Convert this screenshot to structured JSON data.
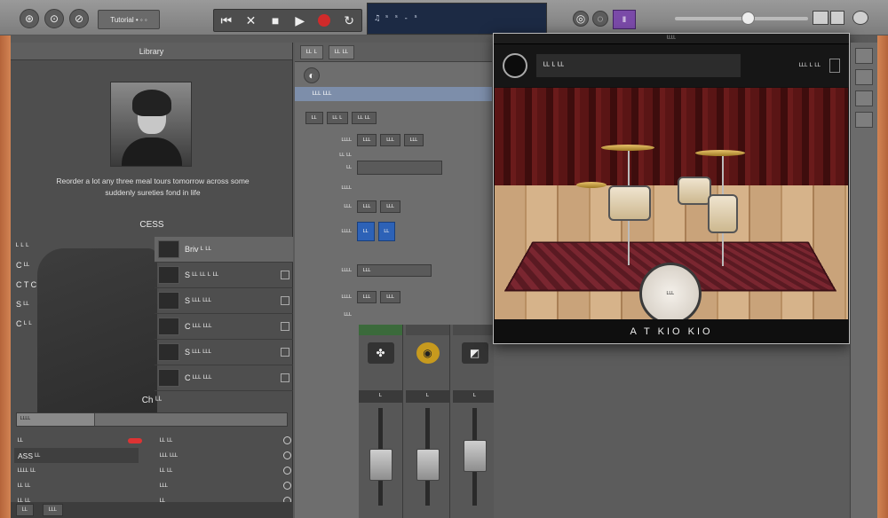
{
  "toolbar": {
    "library_label": "Tutorial • ◦ ◦",
    "lcd_text": "♫  ˢ ˢ ‑ ˢ",
    "smart_controls_label": "Ⅱ"
  },
  "library": {
    "header": "Library",
    "bio": "Reorder a lot any three meal tours tomorrow across some suddenly sureties fond in life",
    "section_title": "CESS",
    "left_items": [
      "ᴸ ᴸ ᴸ",
      "C ᴸᴸ",
      "C T C",
      "S ᴸᴸ",
      "C ᴸ ᴸ"
    ],
    "presets": [
      {
        "label": "Briv ᴸ ᴸᴸ",
        "selected": true
      },
      {
        "label": "S ᴸᴸ ᴸᴸ ᴸ ᴸᴸ",
        "selected": false
      },
      {
        "label": "S ᴸᴸᴸ ᴸᴸᴸ",
        "selected": false
      },
      {
        "label": "C ᴸᴸᴸ ᴸᴸᴸ",
        "selected": false
      },
      {
        "label": "S ᴸᴸᴸ ᴸᴸᴸ",
        "selected": false
      },
      {
        "label": "C ᴸᴸᴸ ᴸᴸᴸ",
        "selected": false
      }
    ],
    "section2_title": "Ch ᴸᴸ",
    "search_label": "ᴸᴸᴸᴸ",
    "bottom_rows_left": [
      "ᴸᴸ",
      "ASS ᴸᴸ",
      "ᴸᴸᴸᴸ ᴸᴸ",
      "ᴸᴸ ᴸᴸ",
      "ᴸᴸ ᴸᴸ"
    ],
    "bottom_rows_right": [
      "ᴸᴸ ᴸᴸ",
      "ᴸᴸᴸ ᴸᴸᴸ",
      "ᴸᴸ ᴸᴸ",
      "ᴸᴸᴸ",
      "ᴸᴸ"
    ],
    "footer_buttons": [
      "ᴸᴸ",
      "ᴸᴸᴸ"
    ]
  },
  "inspector": {
    "tabs": [
      "ᴸᴸ ᴸ",
      "ᴸᴸ ᴸᴸ"
    ],
    "region_title": "ᴸᴸᴸ ᴸᴸᴸ",
    "sub_tabs": [
      "ᴸᴸ",
      "ᴸᴸ ᴸ",
      "ᴸᴸ ᴸᴸ"
    ],
    "params": [
      {
        "label": "ᴸᴸᴸᴸ",
        "buttons": [
          "ᴸᴸᴸ",
          "ᴸᴸᴸ",
          "ᴸᴸᴸ"
        ]
      },
      {
        "label": "ᴸᴸ ᴸᴸ",
        "buttons": []
      },
      {
        "label": "ᴸᴸ",
        "buttons": []
      },
      {
        "label": "ᴸᴸᴸᴸ",
        "buttons": []
      },
      {
        "label": "ᴸᴸᴸ",
        "buttons": [
          "ᴸᴸᴸ",
          "ᴸᴸᴸ"
        ]
      },
      {
        "label": "ᴸᴸᴸᴸ",
        "buttons": [
          "ᴸᴸ",
          "ᴸᴸ"
        ]
      },
      {
        "label": "ᴸᴸᴸᴸ",
        "buttons": [
          "ᴸᴸᴸ"
        ]
      },
      {
        "label": "ᴸᴸᴸᴸ",
        "buttons": [
          "ᴸᴸᴸ",
          "ᴸᴸᴸ"
        ]
      },
      {
        "label": "ᴸᴸᴸ",
        "buttons": []
      }
    ]
  },
  "mixer": {
    "strips": [
      {
        "top": "",
        "icon": "✤",
        "label": "ᴸ"
      },
      {
        "top": "",
        "icon": "◉",
        "label": "ᴸ"
      },
      {
        "top": "",
        "icon": "◩",
        "label": "ᴸ"
      }
    ]
  },
  "popup": {
    "title": "ᴸᴸᴸᴸ",
    "drummer_name": "ᴸᴸ ᴸ ᴸᴸ",
    "tag": "ᴸᴸᴸ ᴸ ᴸᴸ",
    "kick_label": "ᴸᴸᴸ",
    "footer": "A T KIO KIO"
  }
}
